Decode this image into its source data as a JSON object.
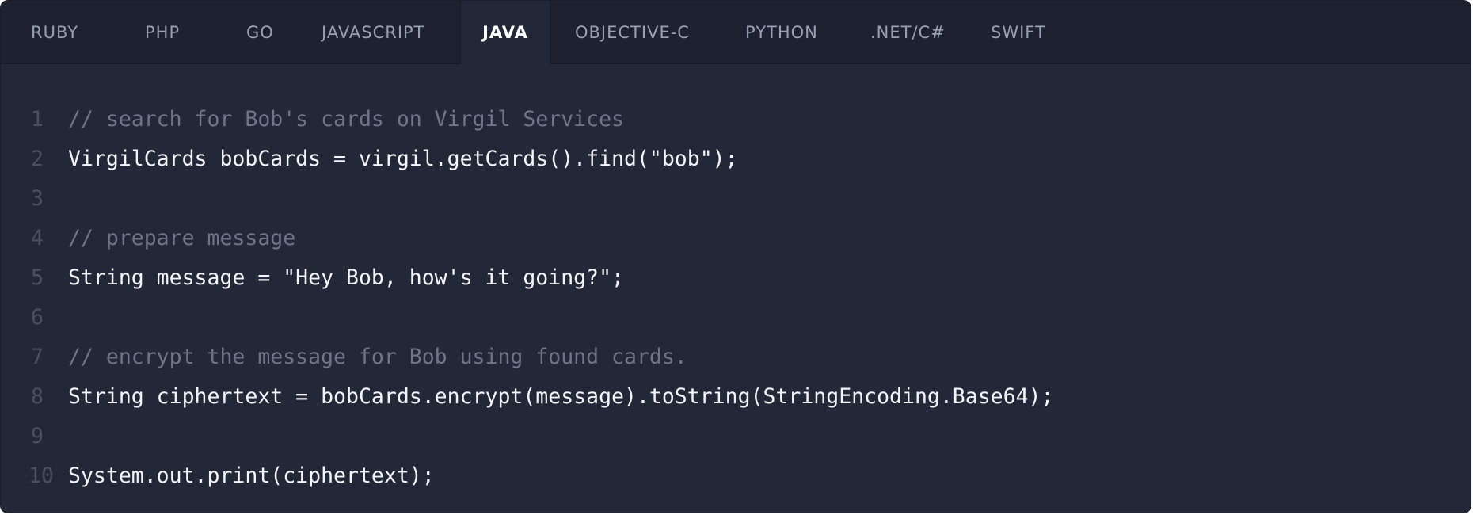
{
  "tabs": [
    {
      "label": "RUBY",
      "active": false
    },
    {
      "label": "PHP",
      "active": false
    },
    {
      "label": "GO",
      "active": false
    },
    {
      "label": "JAVASCRIPT",
      "active": false
    },
    {
      "label": "JAVA",
      "active": true
    },
    {
      "label": "OBJECTIVE-C",
      "active": false
    },
    {
      "label": "PYTHON",
      "active": false
    },
    {
      "label": ".NET/C#",
      "active": false
    },
    {
      "label": "SWIFT",
      "active": false
    }
  ],
  "code": {
    "language": "JAVA",
    "lines": [
      {
        "number": "1",
        "text": "// search for Bob's cards on Virgil Services",
        "kind": "comment"
      },
      {
        "number": "2",
        "text": "VirgilCards bobCards = virgil.getCards().find(\"bob\");",
        "kind": "code"
      },
      {
        "number": "3",
        "text": "",
        "kind": "blank"
      },
      {
        "number": "4",
        "text": "// prepare message",
        "kind": "comment"
      },
      {
        "number": "5",
        "text": "String message = \"Hey Bob, how's it going?\";",
        "kind": "code"
      },
      {
        "number": "6",
        "text": "",
        "kind": "blank"
      },
      {
        "number": "7",
        "text": "// encrypt the message for Bob using found cards.",
        "kind": "comment"
      },
      {
        "number": "8",
        "text": "String ciphertext = bobCards.encrypt(message).toString(StringEncoding.Base64);",
        "kind": "code"
      },
      {
        "number": "9",
        "text": "",
        "kind": "blank"
      },
      {
        "number": "10",
        "text": "System.out.print(ciphertext);",
        "kind": "code"
      }
    ]
  },
  "colors": {
    "panel_background": "#232838",
    "tabbar_background": "#1d2130",
    "tab_text": "#9aa0b3",
    "tab_active_text": "#ffffff",
    "code_text": "#f2f4f8",
    "comment_text": "#6f7589",
    "line_number": "#4a5064"
  }
}
